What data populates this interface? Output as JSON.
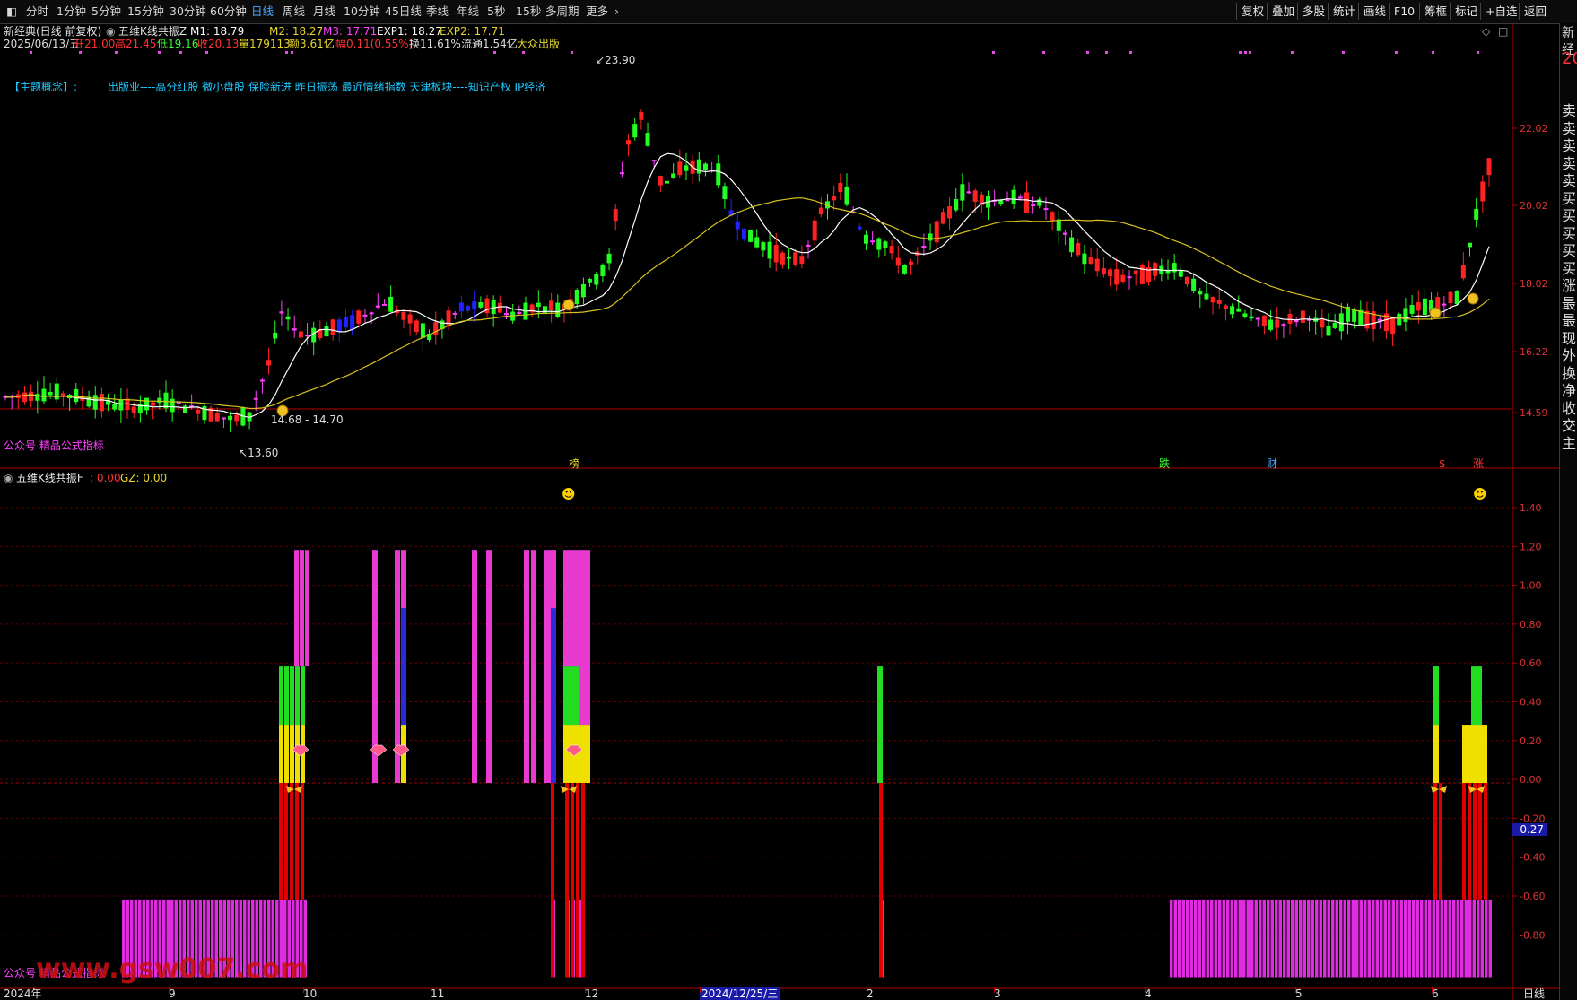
{
  "toolbar": {
    "left_items": [
      "分时",
      "1分钟",
      "5分钟",
      "15分钟",
      "30分钟",
      "60分钟",
      "日线",
      "周线",
      "月线",
      "10分钟",
      "45日线",
      "季线",
      "年线",
      "5秒",
      "15秒",
      "多周期",
      "更多"
    ],
    "active_item": "日线",
    "right_items": [
      "复权",
      "叠加",
      "多股",
      "统计",
      "画线",
      "F10",
      "筹框",
      "标记",
      "+自选",
      "返回"
    ]
  },
  "main_chart": {
    "title": "新经典(日线 前复权)",
    "indicator_name": "五维K线共振Z",
    "m1": "M1: 18.79",
    "m2": "M2: 18.27",
    "m3": "M3: 17.71",
    "exp1": "EXP1: 18.27",
    "exp2": "EXP2: 17.71",
    "quote": {
      "date": "2025/06/13/五",
      "open": "开21.00",
      "high": "高21.45",
      "low": "低19.16",
      "close": "收20.13",
      "volume": "量179113",
      "amount": "额3.61亿",
      "change": "幅0.11(0.55%)",
      "turnover": "换11.61%",
      "float_cap": "流通1.54亿",
      "tag": "大众出版"
    },
    "theme_label": "【主题概念】:",
    "theme_text": "出版业----高分红股 微小盘股 保险新进 昨日振荡 最近情绪指数 天津板块----知识产权 IP经济",
    "watermark": "公众号 精品公式指标",
    "annotations": {
      "high_point": "23.90",
      "low_point": "13.60",
      "range_label": "14.68 - 14.70"
    },
    "y_axis_labels": [
      "22.02",
      "20.02",
      "18.02",
      "16.22",
      "14.59"
    ],
    "event_markers": [
      "榜",
      "跌",
      "财",
      "$",
      "涨"
    ]
  },
  "sub_chart": {
    "indicator_name": "五维K线共振F",
    "f_value": ": 0.00",
    "gz_value": "GZ: 0.00",
    "y_axis_labels": [
      "1.40",
      "1.20",
      "1.00",
      "0.80",
      "0.60",
      "0.40",
      "0.20",
      "0.00",
      "-0.20",
      "-0.40",
      "-0.60",
      "-0.80"
    ],
    "current_value": "-0.27",
    "watermark": "公众号 精品公式指标",
    "site_watermark": "www.gsw007.com"
  },
  "x_axis": {
    "labels": [
      "2024年",
      "9",
      "10",
      "11",
      "12",
      "2024/12/25/三",
      "2",
      "3",
      "4",
      "5",
      "6"
    ],
    "period": "日线"
  },
  "right_panel": {
    "top": "新经",
    "price": "20",
    "items": [
      "卖",
      "卖",
      "卖",
      "卖",
      "卖",
      "买",
      "买",
      "买",
      "买",
      "买",
      "涨",
      "最",
      "最",
      "现",
      "外",
      "换",
      "净",
      "收",
      "交",
      "主"
    ]
  },
  "colors": {
    "up": "#ff2222",
    "down": "#22ff22",
    "neutral": "#ff40ff",
    "special": "#2222ff",
    "ma_white": "#ffffff",
    "ma_yellow": "#d6c21c",
    "axis_red": "#b00000"
  }
}
